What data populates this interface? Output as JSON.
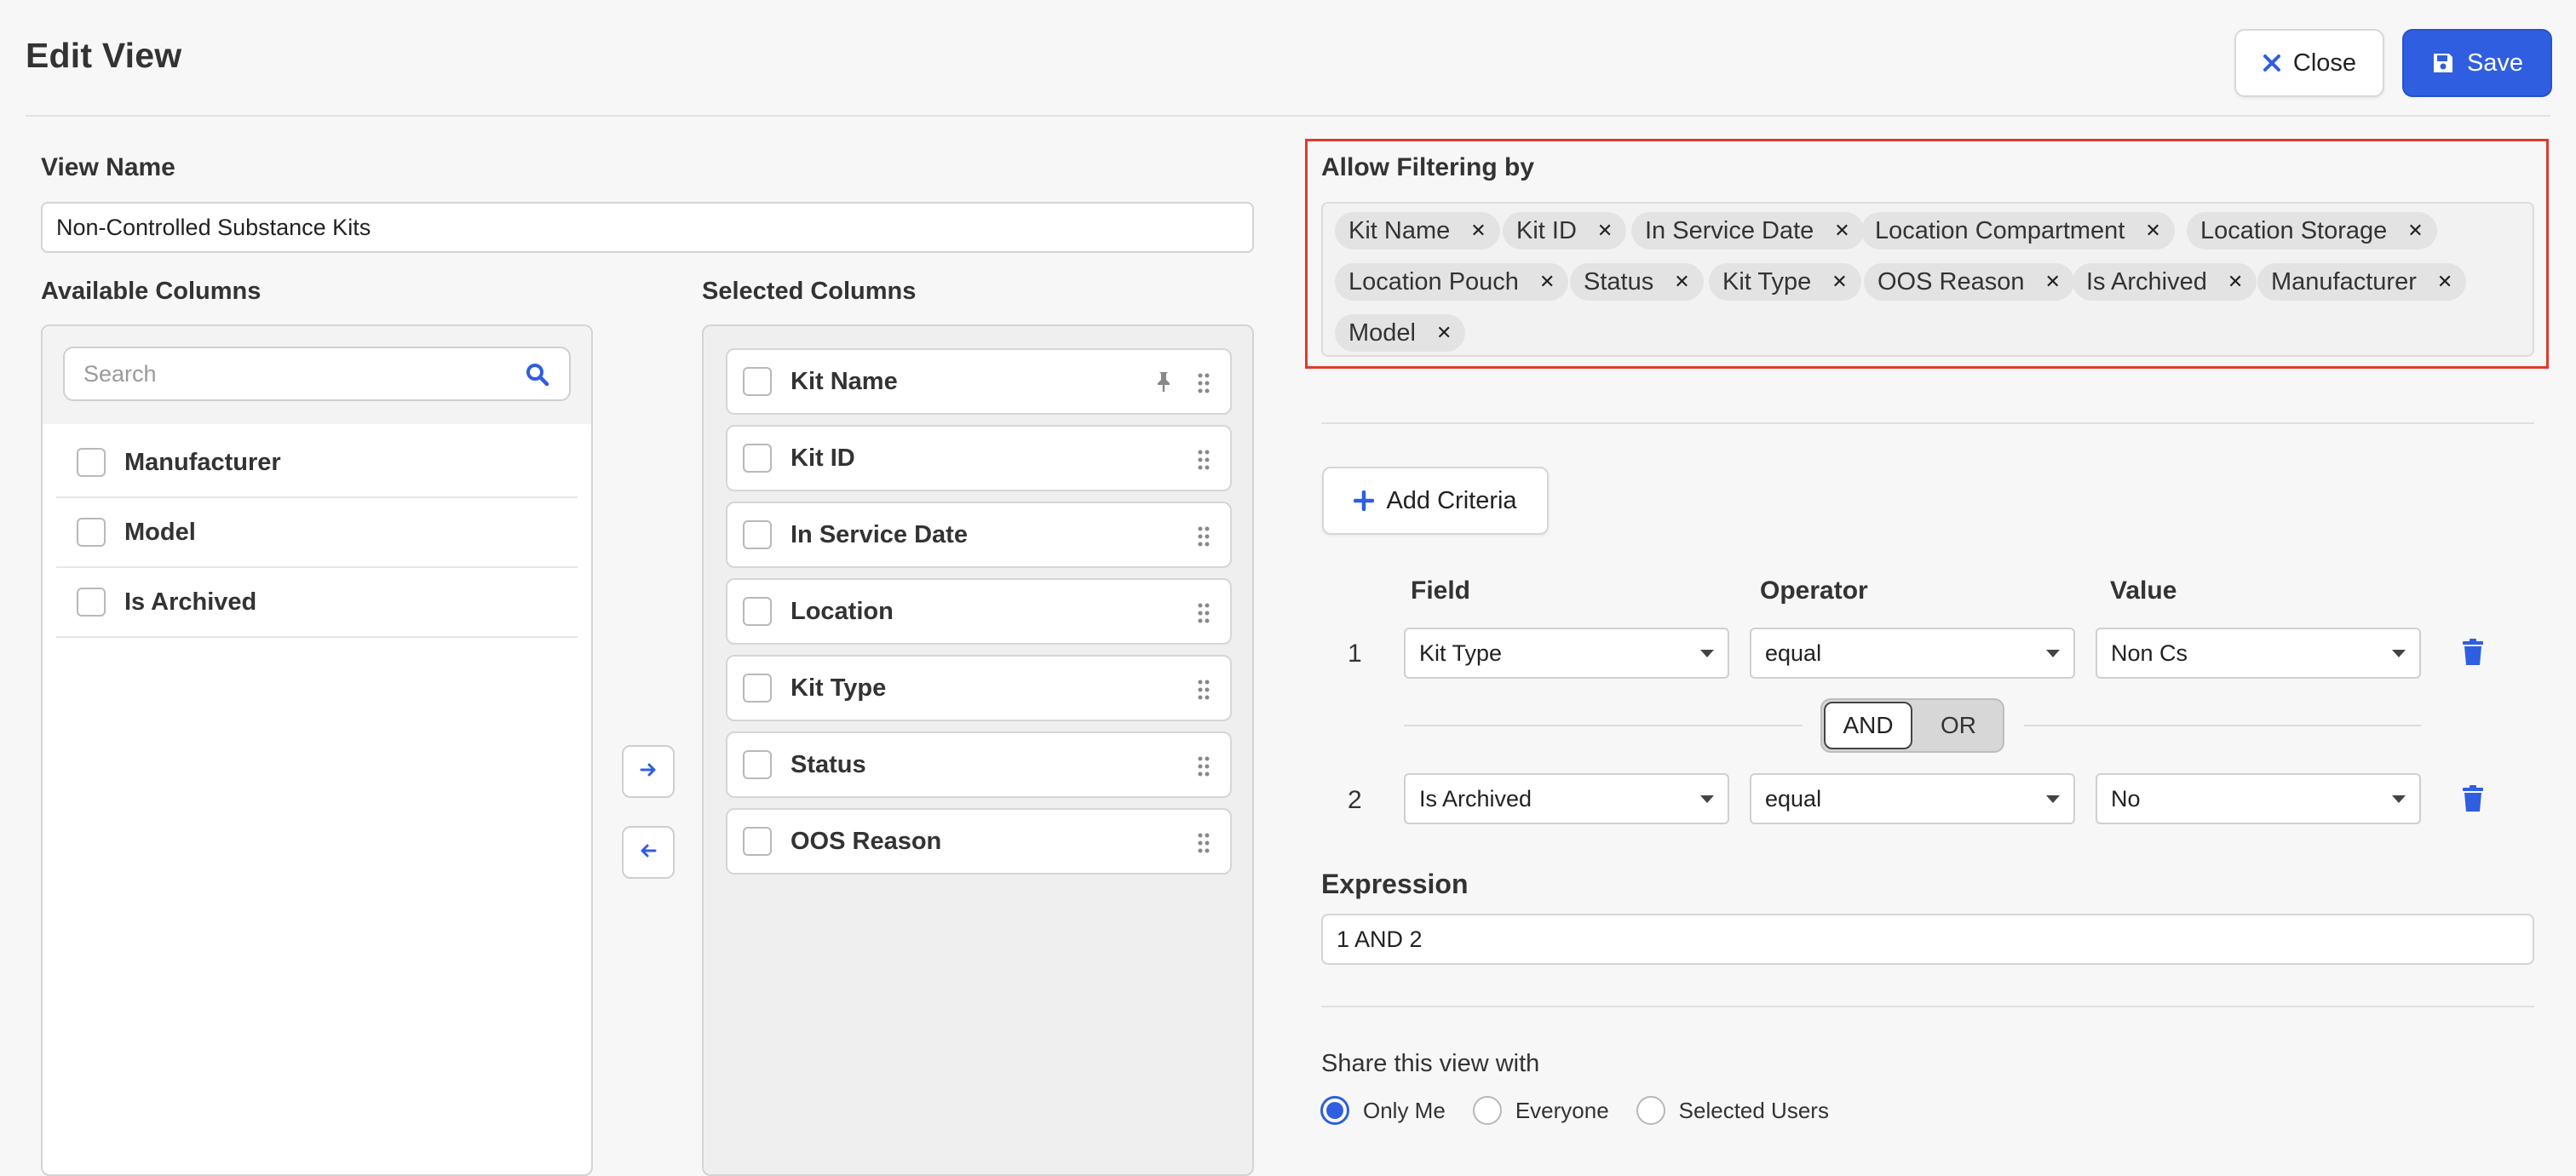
{
  "header": {
    "title": "Edit View",
    "close_label": "Close",
    "save_label": "Save"
  },
  "view_name": {
    "label": "View Name",
    "value": "Non-Controlled Substance Kits"
  },
  "available_columns": {
    "label": "Available Columns",
    "search_placeholder": "Search",
    "items": [
      "Manufacturer",
      "Model",
      "Is Archived"
    ]
  },
  "selected_columns": {
    "label": "Selected Columns",
    "items": [
      "Kit Name",
      "Kit ID",
      "In Service Date",
      "Location",
      "Kit Type",
      "Status",
      "OOS Reason"
    ]
  },
  "filtering": {
    "label": "Allow Filtering by",
    "chips": [
      "Kit Name",
      "Kit ID",
      "In Service Date",
      "Location Compartment",
      "Location Storage",
      "Location Pouch",
      "Status",
      "Kit Type",
      "OOS Reason",
      "Is Archived",
      "Manufacturer",
      "Model"
    ]
  },
  "criteria": {
    "add_label": "Add Criteria",
    "headers": {
      "field": "Field",
      "operator": "Operator",
      "value": "Value"
    },
    "rows": [
      {
        "num": "1",
        "field": "Kit Type",
        "operator": "equal",
        "value": "Non Cs"
      },
      {
        "num": "2",
        "field": "Is Archived",
        "operator": "equal",
        "value": "No"
      }
    ],
    "and_label": "AND",
    "or_label": "OR",
    "selected_logic": "AND"
  },
  "expression": {
    "label": "Expression",
    "value": "1 AND 2"
  },
  "share": {
    "label": "Share this view with",
    "options": [
      "Only Me",
      "Everyone",
      "Selected Users"
    ],
    "selected": "Only Me"
  },
  "colors": {
    "accent": "#2f5ee0",
    "highlight_outline": "#e03a2a"
  }
}
